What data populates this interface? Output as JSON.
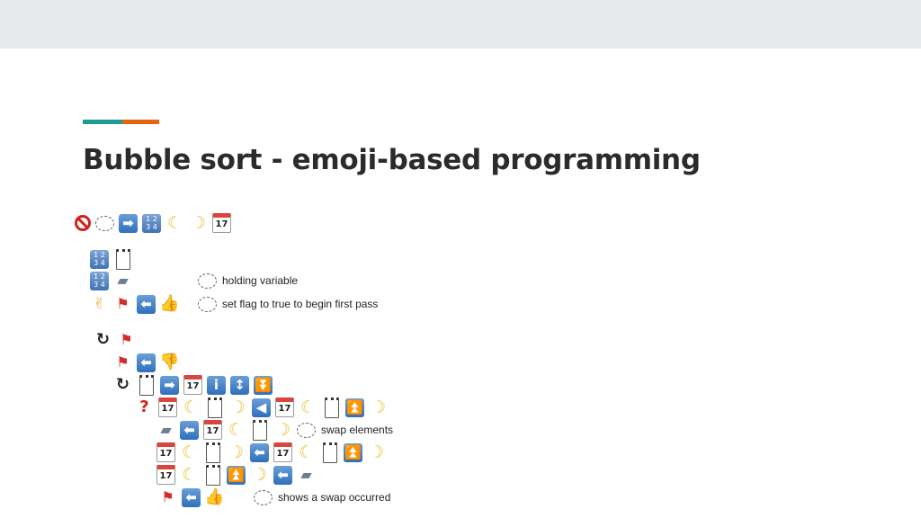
{
  "slide": {
    "title": "Bubble sort - emoji-based programming",
    "colors": {
      "top_bar": "#e7e9ea",
      "accent_teal": "#1f9b92",
      "accent_orange": "#e8630f",
      "title": "#2b2b2b"
    }
  },
  "code": {
    "comments": {
      "holding": "holding variable",
      "flag": "set flag to true to begin first pass",
      "swap": "swap elements",
      "occurred": "shows a swap occurred"
    },
    "lines": [
      [
        "prohibited-icon",
        "thought-bubble-icon",
        "arrow-right-icon",
        "input-numbers-icon",
        "crescent-moon-left-icon",
        "crescent-moon-right-icon",
        "calendar-icon"
      ],
      [
        "input-numbers-icon",
        "notepad-icon"
      ],
      [
        "input-numbers-icon",
        "folder-icon",
        "thought-bubble-icon"
      ],
      [
        "victory-hand-icon",
        "red-flag-icon",
        "arrow-left-icon",
        "thumbs-up-icon",
        "thought-bubble-icon"
      ],
      [
        "loop-icon",
        "red-flag-icon"
      ],
      [
        "red-flag-icon",
        "arrow-left-icon",
        "thumbs-down-icon"
      ],
      [
        "loop-icon",
        "notepad-icon",
        "arrow-right-icon",
        "calendar-icon",
        "information-icon",
        "up-down-arrow-icon",
        "double-down-arrow-icon"
      ],
      [
        "question-mark-icon",
        "calendar-icon",
        "crescent-moon-left-icon",
        "notepad-icon",
        "crescent-moon-right-icon",
        "play-reverse-icon",
        "calendar-icon",
        "crescent-moon-left-icon",
        "notepad-icon",
        "fast-up-icon",
        "crescent-moon-right-icon"
      ],
      [
        "folder-icon",
        "arrow-left-icon",
        "calendar-icon",
        "crescent-moon-left-icon",
        "notepad-icon",
        "crescent-moon-right-icon",
        "thought-bubble-icon"
      ],
      [
        "calendar-icon",
        "crescent-moon-left-icon",
        "notepad-icon",
        "crescent-moon-right-icon",
        "arrow-left-icon",
        "calendar-icon",
        "crescent-moon-left-icon",
        "notepad-icon",
        "fast-up-icon",
        "crescent-moon-right-icon"
      ],
      [
        "calendar-icon",
        "crescent-moon-left-icon",
        "notepad-icon",
        "fast-up-icon",
        "crescent-moon-right-icon",
        "arrow-left-icon",
        "folder-icon"
      ],
      [
        "red-flag-icon",
        "arrow-left-icon",
        "thumbs-up-icon",
        "thought-bubble-icon"
      ]
    ]
  }
}
